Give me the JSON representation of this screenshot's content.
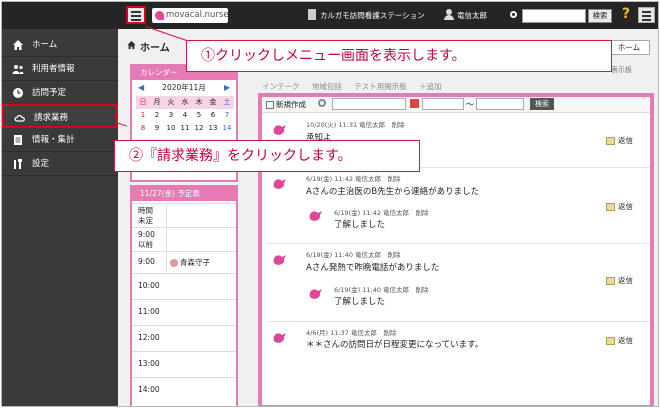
{
  "topbar": {
    "brand": "movacal.nurse",
    "office": "カルガモ訪問看護ステーション",
    "username": "竜信太郎",
    "search_button": "検索",
    "help": "?"
  },
  "sidebar": {
    "items": [
      {
        "label": "ホーム",
        "icon": "home-icon"
      },
      {
        "label": "利用者情報",
        "icon": "users-icon"
      },
      {
        "label": "訪問予定",
        "icon": "clock-icon"
      },
      {
        "label": "請求業務",
        "icon": "cloud-icon"
      },
      {
        "label": "情報・集計",
        "icon": "document-icon"
      },
      {
        "label": "設定",
        "icon": "tools-icon"
      }
    ]
  },
  "main": {
    "title": "ホーム",
    "home_button": "ホーム",
    "right_label": "表示板"
  },
  "calendar": {
    "title": "カレンダー",
    "month": "2020年11月",
    "weekdays": [
      "日",
      "月",
      "火",
      "水",
      "木",
      "金",
      "土"
    ],
    "weeks": [
      [
        "1",
        "2",
        "3",
        "4",
        "5",
        "6",
        "7"
      ],
      [
        "8",
        "9",
        "10",
        "11",
        "12",
        "13",
        "14"
      ]
    ]
  },
  "schedule": {
    "title": "11/27(金) 予定表",
    "rows": [
      {
        "time": "時間\n未定",
        "event": ""
      },
      {
        "time": "9:00\n以前",
        "event": ""
      },
      {
        "time": "9:00",
        "event": "青森守子"
      },
      {
        "time": "10:00",
        "event": ""
      },
      {
        "time": "11:00",
        "event": ""
      },
      {
        "time": "12:00",
        "event": ""
      },
      {
        "time": "13:00",
        "event": ""
      },
      {
        "time": "14:00",
        "event": ""
      }
    ]
  },
  "board": {
    "tabs": [
      "インテーク",
      "地域包括",
      "テスト用掲示板",
      "＋追加"
    ],
    "new_post": "新規作成",
    "range_separator": "〜",
    "search_button": "検索",
    "reply_label": "返信",
    "delete_label": "削除",
    "posts": [
      {
        "meta": "10/20(火) 11:31 竜信太郎",
        "text": "承知よ",
        "reply": {
          "meta": "",
          "text": ""
        }
      },
      {
        "meta": "6/19(金) 11:42 竜信太郎",
        "text": "Aさんの主治医のB先生から連絡がありました",
        "reply": {
          "meta": "6/19(金) 11:42 竜信太郎",
          "text": "了解しました"
        }
      },
      {
        "meta": "6/19(金) 11:40 竜信太郎",
        "text": "Aさん発熱で昨晩電話がありました",
        "reply": {
          "meta": "6/19(金) 11:40 竜信太郎",
          "text": "了解しました"
        }
      },
      {
        "meta": "4/6(月) 11:37 竜信太郎",
        "text": "＊＊さんの訪問日が日程変更になっています。",
        "reply": {
          "meta": "",
          "text": ""
        }
      }
    ]
  },
  "callouts": {
    "step1": "①クリックしメニュー画面を表示します。",
    "step2": "②『請求業務』をクリックします。"
  },
  "colors": {
    "accent_pink": "#e67ab4",
    "highlight_red": "#e0001c",
    "sidebar_bg": "#3a3a3a"
  }
}
